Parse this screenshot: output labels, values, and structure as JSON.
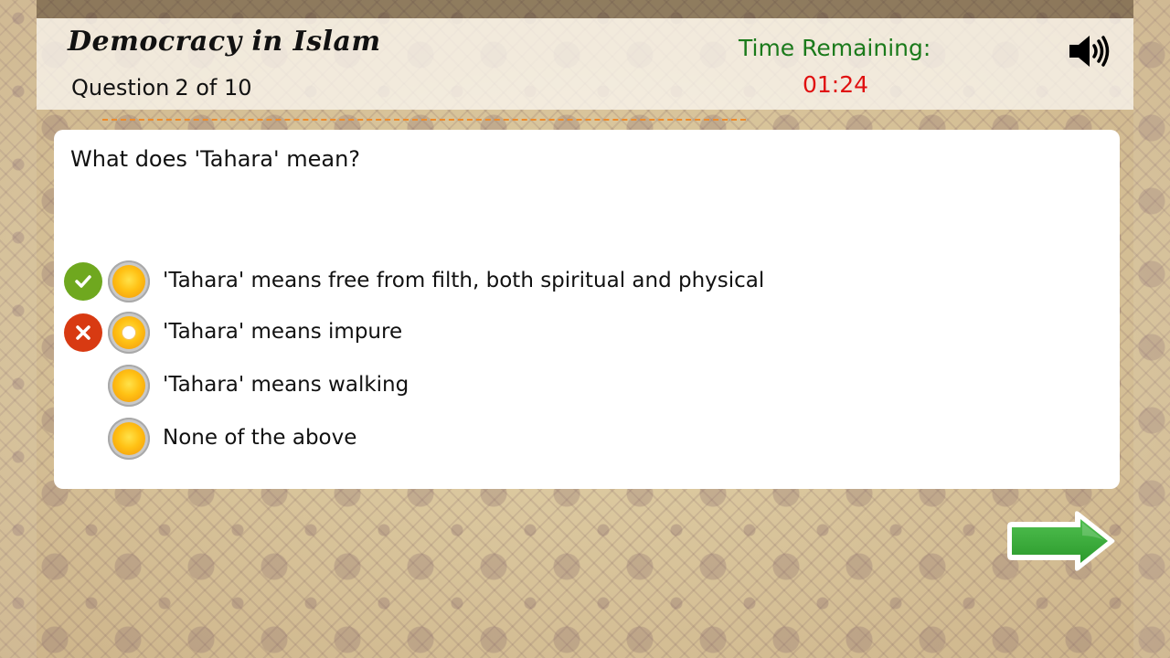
{
  "header": {
    "app_title": "Democracy in Islam",
    "question_label": "Question",
    "question_progress": "2 of 10",
    "time_label": "Time Remaining:",
    "time_value": "01:24",
    "sound_icon": "speaker-volume-icon"
  },
  "question": {
    "text": "What does 'Tahara' mean?",
    "options": [
      {
        "label": "'Tahara' means free from filth, both spiritual and physical",
        "status": "correct",
        "selected": false
      },
      {
        "label": "'Tahara' means impure",
        "status": "wrong",
        "selected": true
      },
      {
        "label": "'Tahara' means walking",
        "status": "none",
        "selected": false
      },
      {
        "label": "None of the above",
        "status": "none",
        "selected": false
      }
    ]
  },
  "navigation": {
    "next_icon": "arrow-right-icon"
  },
  "colors": {
    "time_label": "#1b7a1b",
    "time_value": "#e01010",
    "correct": "#6fa81f",
    "wrong": "#d83a12",
    "next_arrow": "#3aaa3a",
    "dash_line": "#ee8a2a"
  }
}
